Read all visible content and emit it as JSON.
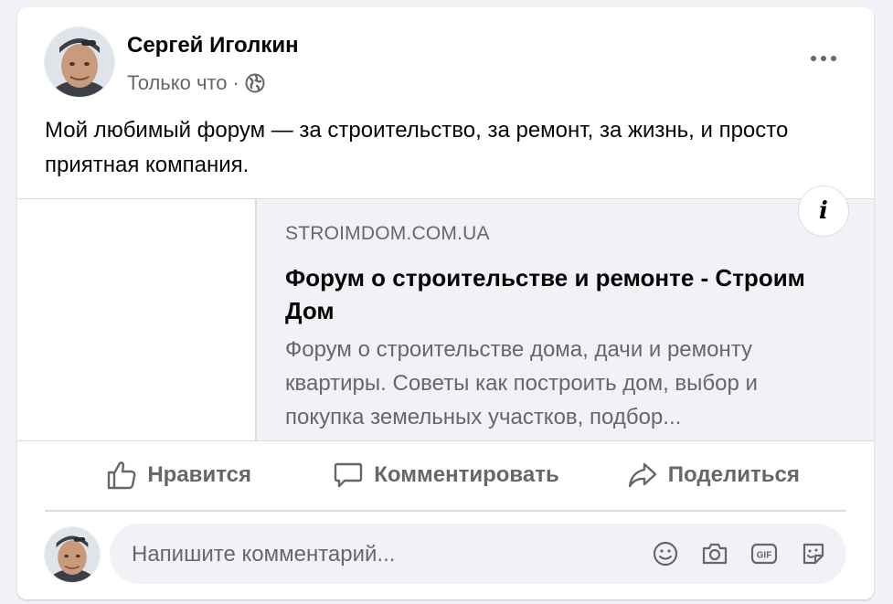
{
  "post": {
    "author": "Сергей Иголкин",
    "time": "Только что",
    "separator": "·",
    "audience_icon": "globe-icon",
    "more_icon": "more-horizontal-icon",
    "text": "Мой любимый форум — за строительство, за ремонт, за жизнь, и просто приятная компания."
  },
  "link_preview": {
    "domain": "STROIMDOM.COM.UA",
    "title": "Форум о строительстве и ремонте - Строим Дом",
    "description": "Форум о строительстве дома, дачи и ремонту квартиры. Советы как построить дом, выбор и покупка земельных участков, подбор...",
    "info_label": "i"
  },
  "actions": {
    "like": "Нравится",
    "comment": "Комментировать",
    "share": "Поделиться"
  },
  "comment": {
    "placeholder": "Напишите комментарий...",
    "icons": [
      "emoji-icon",
      "camera-icon",
      "gif-icon",
      "sticker-icon"
    ]
  },
  "colors": {
    "text_primary": "#050505",
    "text_secondary": "#65676b",
    "background": "#f0f2f5",
    "divider": "#dadde1",
    "card": "#ffffff"
  }
}
